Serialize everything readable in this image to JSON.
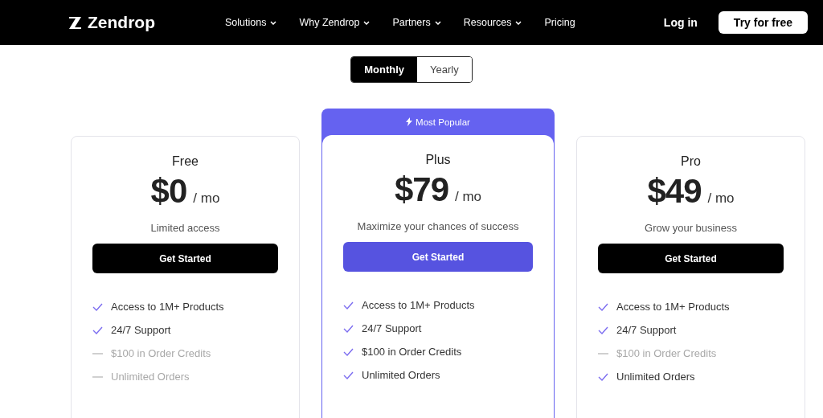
{
  "nav": {
    "logo": "Zendrop",
    "links": [
      {
        "label": "Solutions",
        "dropdown": true
      },
      {
        "label": "Why Zendrop",
        "dropdown": true
      },
      {
        "label": "Partners",
        "dropdown": true
      },
      {
        "label": "Resources",
        "dropdown": true
      },
      {
        "label": "Pricing",
        "dropdown": false
      }
    ],
    "login": "Log in",
    "cta": "Try for free"
  },
  "billing_toggle": [
    {
      "label": "Monthly",
      "selected": true
    },
    {
      "label": "Yearly",
      "selected": false
    }
  ],
  "plans": [
    {
      "name": "Free",
      "price": "$0",
      "period": "/ mo",
      "tagline": "Limited access",
      "button": "Get Started",
      "featured": false,
      "features": [
        {
          "text": "Access to 1M+ Products",
          "included": true
        },
        {
          "text": "24/7 Support",
          "included": true
        },
        {
          "text": "$100 in Order Credits",
          "included": false
        },
        {
          "text": "Unlimited Orders",
          "included": false
        }
      ]
    },
    {
      "name": "Plus",
      "price": "$79",
      "period": "/ mo",
      "tagline": "Maximize your chances of success",
      "button": "Get Started",
      "featured": true,
      "badge": "Most Popular",
      "features": [
        {
          "text": "Access to 1M+ Products",
          "included": true
        },
        {
          "text": "24/7 Support",
          "included": true
        },
        {
          "text": "$100 in Order Credits",
          "included": true
        },
        {
          "text": "Unlimited Orders",
          "included": true
        }
      ]
    },
    {
      "name": "Pro",
      "price": "$49",
      "period": "/ mo",
      "tagline": "Grow your business",
      "button": "Get Started",
      "featured": false,
      "features": [
        {
          "text": "Access to 1M+ Products",
          "included": true
        },
        {
          "text": "24/7 Support",
          "included": true
        },
        {
          "text": "$100 in Order Credits",
          "included": false
        },
        {
          "text": "Unlimited Orders",
          "included": true
        }
      ]
    }
  ]
}
